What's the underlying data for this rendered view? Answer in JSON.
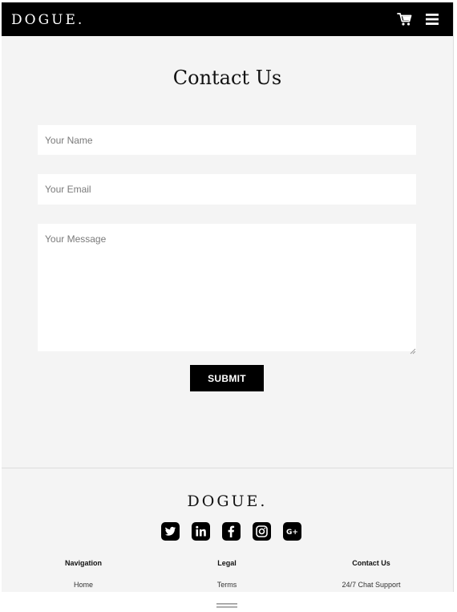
{
  "header": {
    "brand": "DOGUE.",
    "cart_icon": "cart-icon",
    "menu_icon": "hamburger-menu-icon"
  },
  "page": {
    "title": "Contact Us"
  },
  "form": {
    "name_placeholder": "Your Name",
    "email_placeholder": "Your Email",
    "message_placeholder": "Your Message",
    "submit_label": "SUBMIT"
  },
  "footer": {
    "brand": "DOGUE.",
    "socials": [
      "twitter-icon",
      "linkedin-icon",
      "facebook-icon",
      "instagram-icon",
      "google-plus-icon"
    ],
    "columns": [
      {
        "heading": "Navigation",
        "first_link": "Home"
      },
      {
        "heading": "Legal",
        "first_link": "Terms"
      },
      {
        "heading": "Contact Us",
        "first_link": "24/7 Chat Support"
      }
    ]
  },
  "colors": {
    "header_bg": "#000000",
    "page_bg": "#f4f4f4",
    "field_bg": "#ffffff",
    "button_bg": "#000000"
  }
}
